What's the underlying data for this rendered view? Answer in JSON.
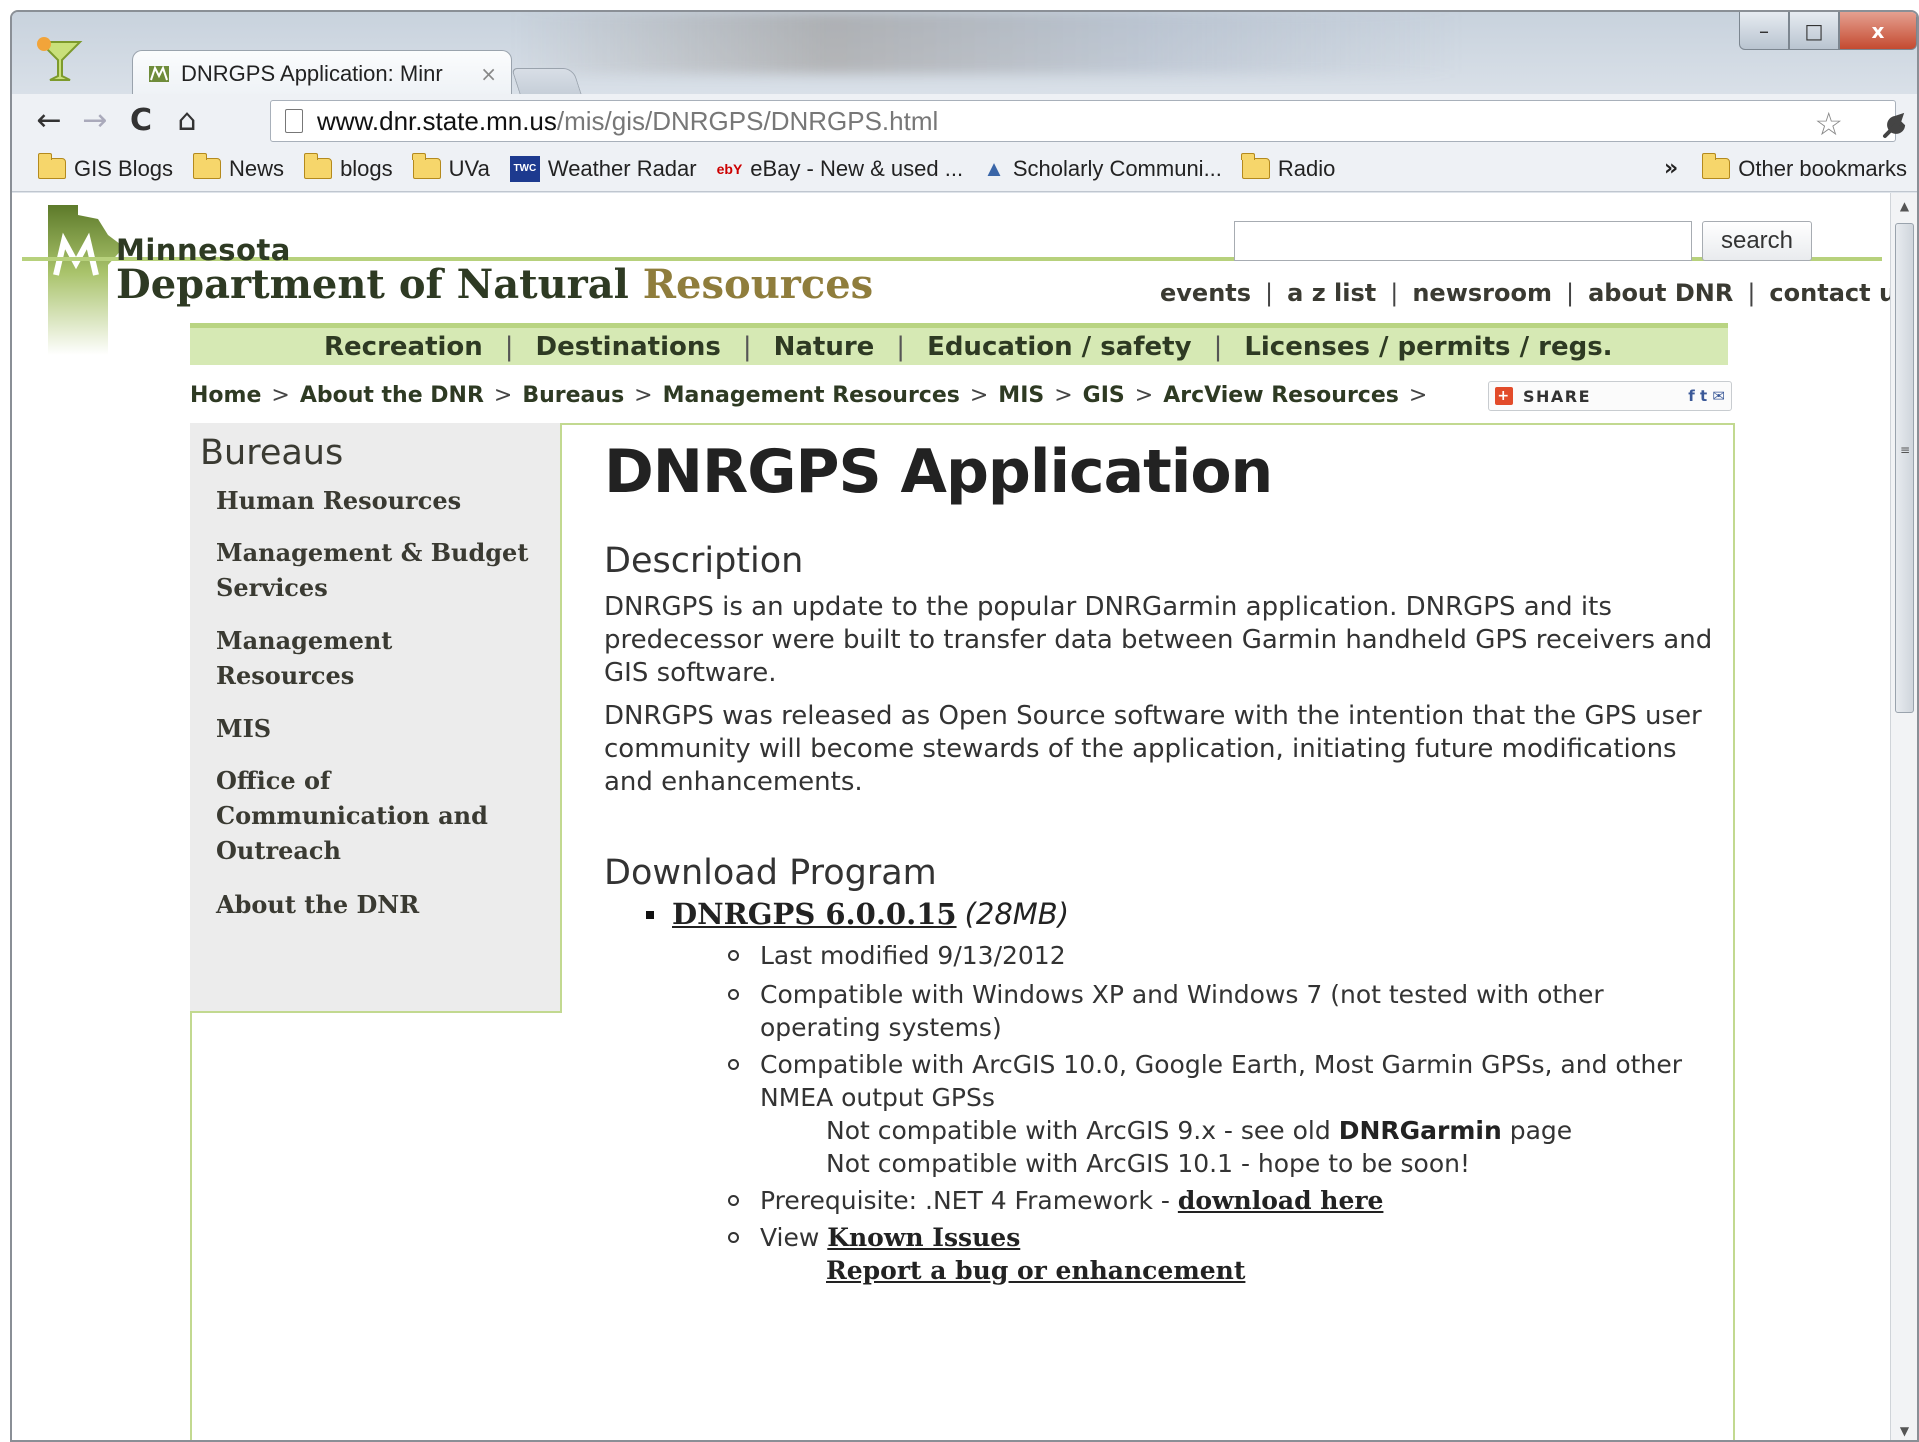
{
  "browser": {
    "tab_title": "DNRGPS Application: Minr",
    "tab_close": "×",
    "url_host": "www.dnr.state.mn.us",
    "url_path": "/mis/gis/DNRGPS/DNRGPS.html",
    "window_buttons": {
      "minimize": "–",
      "maximize": "□",
      "close": "x"
    },
    "nav": {
      "back": "←",
      "forward": "→",
      "reload": "C",
      "home": "⌂"
    },
    "star_icon": "☆",
    "wrench_icon": "🔧",
    "bookmarks": [
      {
        "label": "GIS Blogs",
        "icon": "folder-icon"
      },
      {
        "label": "News",
        "icon": "folder-icon"
      },
      {
        "label": "blogs",
        "icon": "folder-icon"
      },
      {
        "label": "UVa",
        "icon": "folder-icon"
      },
      {
        "label": "Weather Radar",
        "icon": "twc-icon",
        "badge": "TWC"
      },
      {
        "label": "eBay - New & used ...",
        "icon": "ebay-icon",
        "badge": "ebY"
      },
      {
        "label": "Scholarly Communi...",
        "icon": "scholar-icon"
      },
      {
        "label": "Radio",
        "icon": "folder-icon"
      }
    ],
    "bookmarks_overflow": "»",
    "other_bookmarks": "Other bookmarks",
    "accent_tab": "#fbfcfd",
    "accent_close": "#c44a30"
  },
  "site": {
    "logo_state": "Minnesota",
    "logo_dept_prefix": "Department of Natural ",
    "logo_dept_suffix": "Resources",
    "search_placeholder": "",
    "search_button": "search",
    "utility_links": [
      "events",
      "a z list",
      "newsroom",
      "about DNR",
      "contact us"
    ],
    "main_nav": [
      "Recreation",
      "Destinations",
      "Nature",
      "Education / safety",
      "Licenses / permits / regs."
    ],
    "breadcrumb": [
      "Home",
      "About the DNR",
      "Bureaus",
      "Management Resources",
      "MIS",
      "GIS",
      "ArcView Resources"
    ],
    "breadcrumb_sep": ">",
    "share_label": "SHARE",
    "share_services": "f t ✉",
    "colors": {
      "green_bar": "#d6e9b4",
      "green_rule": "#b7d17c",
      "brown": "#8f7d3c",
      "dark": "#2e3a23"
    }
  },
  "sidebar": {
    "heading": "Bureaus",
    "items": [
      "Human Resources",
      "Management & Budget Services",
      "Management Resources",
      "MIS",
      "Office of Communication and Outreach",
      "About the DNR"
    ]
  },
  "main": {
    "title": "DNRGPS Application",
    "description_heading": "Description",
    "description_p1": "DNRGPS is an update to the popular DNRGarmin application. DNRGPS and its predecessor were built to transfer data between Garmin handheld GPS receivers and GIS software.",
    "description_p2": "DNRGPS was released as Open Source software with the intention that the GPS user community will become stewards of the application, initiating future modifications and enhancements.",
    "download_heading": "Download Program",
    "download_link": "DNRGPS 6.0.0.15",
    "download_size": "(28MB)",
    "details": {
      "last_modified": "Last modified 9/13/2012",
      "compat_windows": "Compatible with Windows XP and Windows 7 (not tested with other operating systems)",
      "compat_arcgis": "Compatible with ArcGIS 10.0, Google Earth, Most Garmin GPSs, and other NMEA output GPSs",
      "not_compat_9_prefix": "Not compatible with ArcGIS 9.x - see old ",
      "not_compat_9_link": "DNRGarmin",
      "not_compat_9_suffix": " page",
      "not_compat_10_1": "Not compatible with ArcGIS 10.1 - hope to be soon!",
      "prereq_prefix": "Prerequisite: .NET 4 Framework - ",
      "prereq_link": "download here",
      "view_prefix": "View ",
      "view_link": "Known Issues",
      "report_link": "Report a bug or enhancement"
    }
  }
}
